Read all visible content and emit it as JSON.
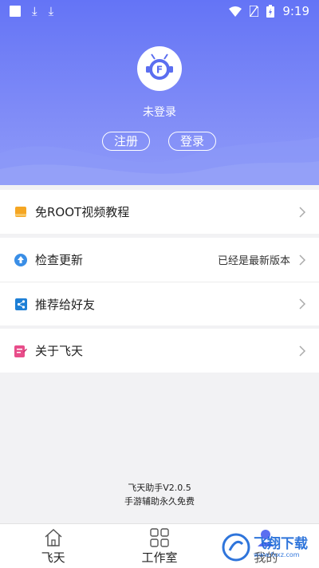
{
  "status_bar": {
    "time": "9:19"
  },
  "profile": {
    "username": "未登录",
    "register_label": "注册",
    "login_label": "登录"
  },
  "menu": {
    "tutorial": {
      "label": "免ROOT视频教程"
    },
    "update": {
      "label": "检查更新",
      "value": "已经是最新版本"
    },
    "share": {
      "label": "推荐给好友"
    },
    "about": {
      "label": "关于飞天"
    }
  },
  "footer": {
    "version": "飞天助手V2.0.5",
    "tagline": "手游辅助永久免费"
  },
  "tabs": [
    {
      "label": "飞天",
      "icon": "home-icon"
    },
    {
      "label": "工作室",
      "icon": "grid-icon"
    },
    {
      "label": "我的",
      "icon": "user-icon"
    }
  ],
  "watermark": {
    "title": "飞翔下载",
    "url": "www.fxxz.com"
  },
  "colors": {
    "header": "#6474f6",
    "accent_orange": "#f5a623",
    "accent_blue": "#3a8ee6",
    "accent_pink": "#e84d8a"
  }
}
